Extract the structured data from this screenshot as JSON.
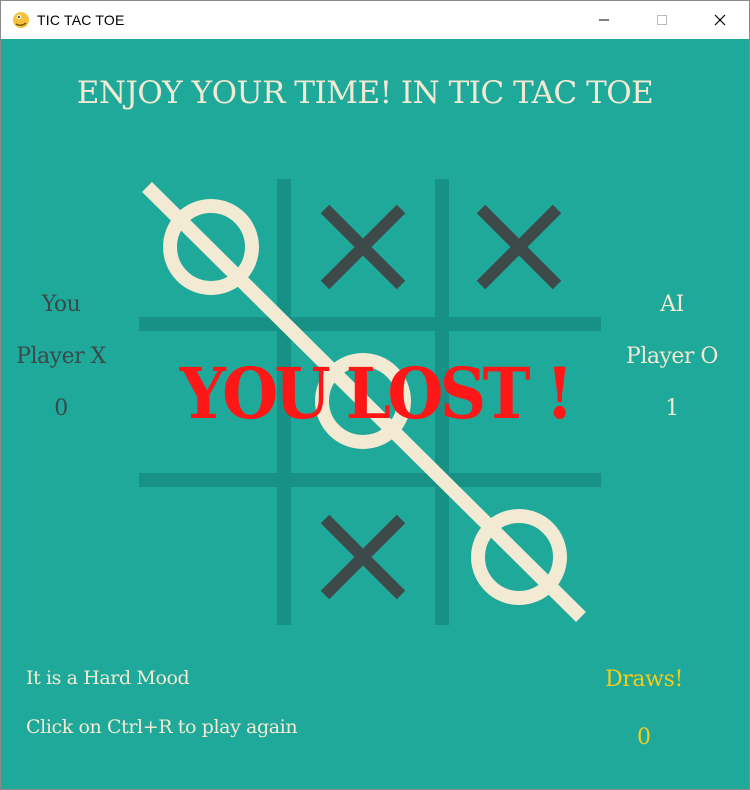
{
  "window": {
    "title": "TIC TAC TOE",
    "app_icon": "python-snake-icon"
  },
  "heading": "ENJOY YOUR TIME! IN TIC TAC TOE",
  "board": {
    "cells": [
      "O",
      "X",
      "X",
      "",
      "O",
      "",
      "",
      "X",
      "O"
    ],
    "winning_line": "diagonal-top-left-to-bottom-right",
    "colors": {
      "grid": "#179085",
      "x_mark": "#3d4a49",
      "o_mark": "#f2ead3",
      "win_line": "#f2ead3"
    }
  },
  "player": {
    "name": "You",
    "label": "Player X",
    "score": "0"
  },
  "ai": {
    "name": "AI",
    "label": "Player O",
    "score": "1"
  },
  "result": "YOU LOST !",
  "info": {
    "mood": "It is a Hard Mood",
    "restart_hint": "Click on Ctrl+R to play again"
  },
  "draws": {
    "label": "Draws!",
    "count": "0"
  },
  "colors": {
    "background": "#1fa99a",
    "text_light": "#f2ead3",
    "text_dark": "#3a4a4a",
    "lost": "#ff1616",
    "draws": "#f3cd1a"
  }
}
